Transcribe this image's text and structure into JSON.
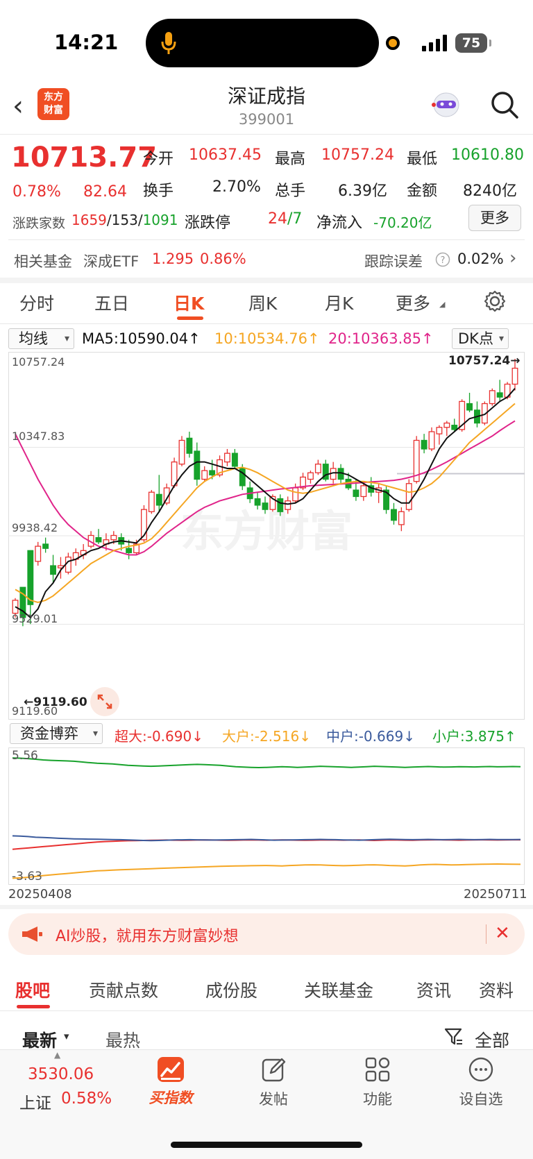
{
  "status": {
    "time": "14:21",
    "battery": "75"
  },
  "header": {
    "title": "深证成指",
    "code": "399001",
    "logo_text": "东方财富"
  },
  "quote": {
    "price": "10713.77",
    "change_pct": "0.78%",
    "change": "82.64",
    "open_label": "今开",
    "open": "10637.45",
    "high_label": "最高",
    "high": "10757.24",
    "low_label": "最低",
    "low": "10610.80",
    "turnover_label": "换手",
    "turnover": "2.70%",
    "volume_label": "总手",
    "volume": "6.39亿",
    "amount_label": "金额",
    "amount": "8240亿",
    "breadth_label": "涨跌家数",
    "up": "1659",
    "flat": "/153/",
    "down": "1091",
    "limit_label": "涨跌停",
    "limit_up": "24",
    "limit_down": "/7",
    "netflow_label": "净流入",
    "netflow": "-70.20亿",
    "more_label": "更多",
    "fund_label": "相关基金",
    "fund_name": "深成ETF",
    "fund_price": "1.295",
    "fund_pct": "0.86%",
    "tracking_label": "跟踪误差",
    "tracking": "0.02%"
  },
  "tabs": [
    "分时",
    "五日",
    "日K",
    "周K",
    "月K",
    "更多"
  ],
  "chart": {
    "indicator": "均线",
    "ma5": "MA5:10590.04↑",
    "ma10": "10:10534.76↑",
    "ma20": "20:10363.85↑",
    "dk": "DK点",
    "axis_labels": [
      "10757.24",
      "10347.83",
      "9938.42",
      "9529.01",
      "9119.60"
    ],
    "high_marker": "10757.24→",
    "low_marker": "←9119.60",
    "flow_indicator": "资金博弈",
    "flow_super": "超大:-0.690↓",
    "flow_big": "大户:-2.516↓",
    "flow_mid": "中户:-0.669↓",
    "flow_small": "小户:3.875↑",
    "flow_top": "5.56",
    "flow_bottom": "-3.63",
    "date_start": "20250408",
    "date_end": "20250711",
    "colors": {
      "up": "#e8302f",
      "down": "#17a22b",
      "ma5": "#111111",
      "ma10": "#f5a623",
      "ma20": "#e0248a"
    }
  },
  "chart_data": {
    "type": "candlestick",
    "ylim": [
      9119.6,
      10757.24
    ],
    "candles": [
      [
        9580,
        9650,
        9560,
        9640
      ],
      [
        9700,
        9680,
        9520,
        9560
      ],
      [
        9870,
        9810,
        9530,
        9620
      ],
      [
        9820,
        9910,
        9800,
        9890
      ],
      [
        9900,
        9930,
        9860,
        9880
      ],
      [
        9800,
        9850,
        9720,
        9760
      ],
      [
        9790,
        9840,
        9740,
        9800
      ],
      [
        9770,
        9860,
        9760,
        9840
      ],
      [
        9830,
        9880,
        9800,
        9860
      ],
      [
        9850,
        9900,
        9830,
        9870
      ],
      [
        9890,
        9960,
        9880,
        9940
      ],
      [
        9930,
        9970,
        9900,
        9910
      ],
      [
        9900,
        9950,
        9870,
        9920
      ],
      [
        9920,
        9960,
        9900,
        9940
      ],
      [
        9930,
        9950,
        9870,
        9900
      ],
      [
        9880,
        9920,
        9830,
        9860
      ],
      [
        9860,
        9920,
        9850,
        9900
      ],
      [
        9920,
        10080,
        9910,
        10060
      ],
      [
        10050,
        10150,
        10040,
        10140
      ],
      [
        10130,
        10220,
        10050,
        10080
      ],
      [
        10090,
        10180,
        10080,
        10160
      ],
      [
        10170,
        10300,
        10160,
        10280
      ],
      [
        10270,
        10400,
        10260,
        10380
      ],
      [
        10390,
        10420,
        10300,
        10320
      ],
      [
        10330,
        10370,
        10170,
        10200
      ],
      [
        10200,
        10260,
        10190,
        10240
      ],
      [
        10240,
        10290,
        10200,
        10220
      ],
      [
        10220,
        10310,
        10210,
        10290
      ],
      [
        10280,
        10340,
        10260,
        10320
      ],
      [
        10320,
        10340,
        10250,
        10260
      ],
      [
        10250,
        10270,
        10150,
        10170
      ],
      [
        10160,
        10190,
        10090,
        10110
      ],
      [
        10110,
        10140,
        10060,
        10080
      ],
      [
        10090,
        10120,
        10040,
        10060
      ],
      [
        10060,
        10130,
        10050,
        10120
      ],
      [
        10110,
        10130,
        10030,
        10050
      ],
      [
        10060,
        10120,
        10040,
        10100
      ],
      [
        10100,
        10180,
        10090,
        10160
      ],
      [
        10160,
        10230,
        10150,
        10210
      ],
      [
        10200,
        10240,
        10180,
        10230
      ],
      [
        10230,
        10290,
        10220,
        10270
      ],
      [
        10270,
        10290,
        10190,
        10200
      ],
      [
        10200,
        10280,
        10180,
        10250
      ],
      [
        10250,
        10270,
        10180,
        10200
      ],
      [
        10200,
        10230,
        10150,
        10160
      ],
      [
        10150,
        10200,
        10100,
        10120
      ],
      [
        10120,
        10190,
        10100,
        10170
      ],
      [
        10170,
        10210,
        10120,
        10140
      ],
      [
        10140,
        10180,
        10090,
        10160
      ],
      [
        10150,
        10170,
        10040,
        10060
      ],
      [
        10060,
        10090,
        9990,
        10010
      ],
      [
        9990,
        10070,
        9960,
        10050
      ],
      [
        10060,
        10200,
        10050,
        10180
      ],
      [
        10190,
        10400,
        10180,
        10380
      ],
      [
        10380,
        10410,
        10320,
        10340
      ],
      [
        10340,
        10440,
        10330,
        10420
      ],
      [
        10410,
        10450,
        10360,
        10440
      ],
      [
        10440,
        10470,
        10400,
        10460
      ],
      [
        10450,
        10480,
        10420,
        10430
      ],
      [
        10430,
        10570,
        10420,
        10560
      ],
      [
        10550,
        10600,
        10510,
        10520
      ],
      [
        10520,
        10560,
        10440,
        10460
      ],
      [
        10460,
        10560,
        10450,
        10550
      ],
      [
        10550,
        10620,
        10540,
        10610
      ],
      [
        10600,
        10660,
        10560,
        10580
      ],
      [
        10580,
        10650,
        10570,
        10640
      ],
      [
        10640,
        10757.24,
        10610.8,
        10713.77
      ]
    ],
    "ma5": [
      9610,
      9590,
      9560,
      9600,
      9680,
      9720,
      9780,
      9820,
      9830,
      9850,
      9870,
      9880,
      9900,
      9910,
      9915,
      9910,
      9905,
      9940,
      10000,
      10050,
      10110,
      10170,
      10220,
      10260,
      10280,
      10280,
      10270,
      10260,
      10250,
      10250,
      10230,
      10200,
      10170,
      10140,
      10110,
      10090,
      10085,
      10090,
      10110,
      10150,
      10190,
      10220,
      10230,
      10230,
      10220,
      10200,
      10180,
      10160,
      10150,
      10140,
      10110,
      10090,
      10090,
      10140,
      10200,
      10270,
      10340,
      10390,
      10420,
      10450,
      10480,
      10490,
      10500,
      10530,
      10560,
      10580,
      10620
    ],
    "ma10": [
      9690,
      9670,
      9640,
      9630,
      9640,
      9660,
      9690,
      9720,
      9750,
      9780,
      9810,
      9830,
      9850,
      9870,
      9880,
      9890,
      9895,
      9905,
      9925,
      9960,
      10000,
      10040,
      10080,
      10120,
      10160,
      10190,
      10210,
      10230,
      10240,
      10250,
      10255,
      10245,
      10230,
      10210,
      10190,
      10170,
      10150,
      10140,
      10135,
      10140,
      10150,
      10160,
      10170,
      10180,
      10185,
      10190,
      10190,
      10185,
      10180,
      10170,
      10160,
      10150,
      10140,
      10145,
      10160,
      10180,
      10210,
      10250,
      10290,
      10330,
      10370,
      10400,
      10430,
      10460,
      10490,
      10520,
      10550
    ],
    "ma20": [
      10410,
      10340,
      10270,
      10200,
      10140,
      10080,
      10030,
      9990,
      9960,
      9930,
      9910,
      9890,
      9880,
      9870,
      9860,
      9850,
      9850,
      9865,
      9890,
      9920,
      9950,
      9975,
      10000,
      10025,
      10050,
      10070,
      10085,
      10100,
      10110,
      10120,
      10130,
      10135,
      10140,
      10145,
      10150,
      10155,
      10158,
      10162,
      10166,
      10170,
      10172,
      10174,
      10176,
      10178,
      10180,
      10182,
      10185,
      10188,
      10190,
      10192,
      10195,
      10200,
      10208,
      10218,
      10230,
      10245,
      10262,
      10280,
      10300,
      10320,
      10340,
      10360,
      10380,
      10400,
      10425,
      10448,
      10470
    ],
    "flow": {
      "small": [
        5.4,
        5.38,
        5.35,
        5.3,
        5.25,
        5.22,
        5.2,
        5.18,
        5.15,
        5.1,
        5.05,
        5.0,
        4.98,
        4.95,
        4.9,
        4.85,
        4.82,
        4.8,
        4.78,
        4.8,
        4.82,
        4.85,
        4.88,
        4.9,
        4.92,
        4.9,
        4.88,
        4.85,
        4.8,
        4.75,
        4.72,
        4.7,
        4.68,
        4.7,
        4.72,
        4.75,
        4.73,
        4.7,
        4.72,
        4.75,
        4.78,
        4.76,
        4.74,
        4.72,
        4.7,
        4.72,
        4.75,
        4.78,
        4.76,
        4.74,
        4.72,
        4.7,
        4.72,
        4.74,
        4.76,
        4.74,
        4.72,
        4.73,
        4.75,
        4.74,
        4.73,
        4.75,
        4.76,
        4.74,
        4.75,
        4.76,
        4.75
      ],
      "super": [
        -1.4,
        -1.35,
        -1.3,
        -1.25,
        -1.2,
        -1.15,
        -1.1,
        -1.05,
        -1.0,
        -0.95,
        -0.9,
        -0.85,
        -0.82,
        -0.8,
        -0.78,
        -0.76,
        -0.75,
        -0.74,
        -0.73,
        -0.72,
        -0.71,
        -0.72,
        -0.73,
        -0.72,
        -0.71,
        -0.7,
        -0.71,
        -0.72,
        -0.73,
        -0.72,
        -0.71,
        -0.7,
        -0.71,
        -0.72,
        -0.71,
        -0.7,
        -0.71,
        -0.72,
        -0.73,
        -0.72,
        -0.71,
        -0.7,
        -0.71,
        -0.72,
        -0.71,
        -0.7,
        -0.72,
        -0.74,
        -0.72,
        -0.7,
        -0.71,
        -0.72,
        -0.73,
        -0.71,
        -0.7,
        -0.69,
        -0.7,
        -0.71,
        -0.72,
        -0.71,
        -0.7,
        -0.69,
        -0.7,
        -0.71,
        -0.7,
        -0.69,
        -0.69
      ],
      "mid": [
        -0.4,
        -0.42,
        -0.45,
        -0.5,
        -0.52,
        -0.55,
        -0.58,
        -0.6,
        -0.62,
        -0.63,
        -0.64,
        -0.65,
        -0.66,
        -0.67,
        -0.68,
        -0.7,
        -0.72,
        -0.74,
        -0.75,
        -0.74,
        -0.72,
        -0.7,
        -0.69,
        -0.68,
        -0.69,
        -0.7,
        -0.71,
        -0.7,
        -0.69,
        -0.68,
        -0.67,
        -0.66,
        -0.68,
        -0.7,
        -0.72,
        -0.71,
        -0.7,
        -0.69,
        -0.68,
        -0.67,
        -0.66,
        -0.67,
        -0.68,
        -0.7,
        -0.71,
        -0.72,
        -0.7,
        -0.68,
        -0.66,
        -0.65,
        -0.66,
        -0.67,
        -0.68,
        -0.67,
        -0.66,
        -0.67,
        -0.68,
        -0.67,
        -0.66,
        -0.67,
        -0.68,
        -0.67,
        -0.66,
        -0.67,
        -0.67,
        -0.67,
        -0.669
      ],
      "big": [
        -3.55,
        -3.52,
        -3.48,
        -3.42,
        -3.35,
        -3.3,
        -3.25,
        -3.2,
        -3.15,
        -3.1,
        -3.05,
        -3.0,
        -2.98,
        -2.95,
        -2.92,
        -2.9,
        -2.88,
        -2.86,
        -2.84,
        -2.82,
        -2.8,
        -2.78,
        -2.76,
        -2.74,
        -2.72,
        -2.7,
        -2.68,
        -2.66,
        -2.65,
        -2.64,
        -2.63,
        -2.62,
        -2.61,
        -2.6,
        -2.62,
        -2.64,
        -2.6,
        -2.58,
        -2.56,
        -2.55,
        -2.56,
        -2.58,
        -2.6,
        -2.62,
        -2.6,
        -2.58,
        -2.56,
        -2.55,
        -2.57,
        -2.6,
        -2.62,
        -2.64,
        -2.6,
        -2.56,
        -2.53,
        -2.52,
        -2.54,
        -2.56,
        -2.55,
        -2.53,
        -2.52,
        -2.51,
        -2.5,
        -2.49,
        -2.5,
        -2.51,
        -2.516
      ]
    },
    "flow_ylim": [
      -3.63,
      5.56
    ]
  },
  "banner": {
    "text": "AI炒股，就用东方财富妙想"
  },
  "bottom_tabs": [
    "股吧",
    "贡献点数",
    "成份股",
    "关联基金",
    "资讯",
    "资料"
  ],
  "sort": {
    "latest": "最新",
    "hot": "最热",
    "filter": "全部"
  },
  "nav": {
    "index_value": "3530.06",
    "index_name": "上证",
    "index_pct": "0.58%",
    "buy_index": "买指数",
    "post": "发帖",
    "functions": "功能",
    "watchlist": "设自选"
  }
}
